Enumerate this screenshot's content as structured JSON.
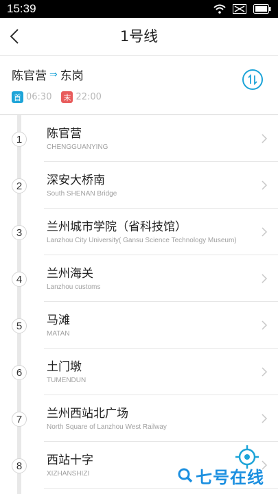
{
  "status_bar": {
    "time": "15:39"
  },
  "header": {
    "title": "1号线"
  },
  "route": {
    "from": "陈官营",
    "arrow": "⇒",
    "to": "东岗",
    "first_badge": "首",
    "first_time": "06:30",
    "last_badge": "末",
    "last_time": "22:00"
  },
  "stations": [
    {
      "number": "1",
      "name": "陈官营",
      "pinyin": "CHENGGUANYING"
    },
    {
      "number": "2",
      "name": "深安大桥南",
      "pinyin": "South SHENAN Bridge"
    },
    {
      "number": "3",
      "name": "兰州城市学院（省科技馆）",
      "pinyin": "Lanzhou City University( Gansu Science Technology Museum)"
    },
    {
      "number": "4",
      "name": "兰州海关",
      "pinyin": "Lanzhou customs"
    },
    {
      "number": "5",
      "name": "马滩",
      "pinyin": "MATAN"
    },
    {
      "number": "6",
      "name": "土门墩",
      "pinyin": "TUMENDUN"
    },
    {
      "number": "7",
      "name": "兰州西站北广场",
      "pinyin": "North Square of Lanzhou West Railway"
    },
    {
      "number": "8",
      "name": "西站十字",
      "pinyin": "XIZHANSHIZI"
    }
  ],
  "watermark": {
    "text": "七号在线"
  },
  "colors": {
    "accent": "#1da4d8",
    "first_badge": "#1da4d8",
    "last_badge": "#e85c5c",
    "watermark": "#1b8fe0"
  },
  "icons": {
    "back": "chevron-left-icon",
    "swap": "swap-direction-icon",
    "row": "chevron-right-icon",
    "locate": "locate-icon",
    "wifi": "wifi-icon",
    "signal": "signal-icon",
    "battery": "battery-icon"
  }
}
